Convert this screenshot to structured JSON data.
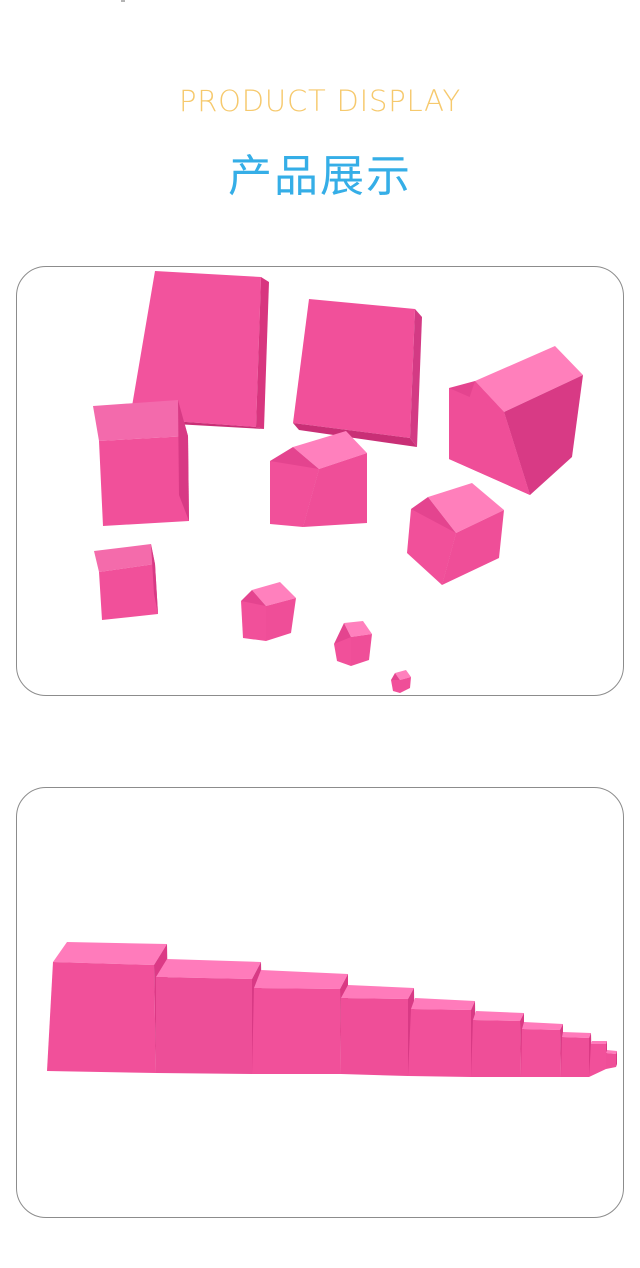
{
  "header": {
    "english_title": "PRODUCT DISPLAY",
    "chinese_title": "产品展示"
  },
  "colors": {
    "english_title": "#f6c96d",
    "chinese_title": "#35aee7",
    "panel_border": "#8c8c8c",
    "cube_front": "#f1509a",
    "cube_top": "#ff78b7",
    "cube_side": "#dc3a86"
  },
  "gallery": {
    "panel_1": {
      "image": "scattered-pink-cubes"
    },
    "panel_2": {
      "image": "pink-cubes-row"
    }
  }
}
